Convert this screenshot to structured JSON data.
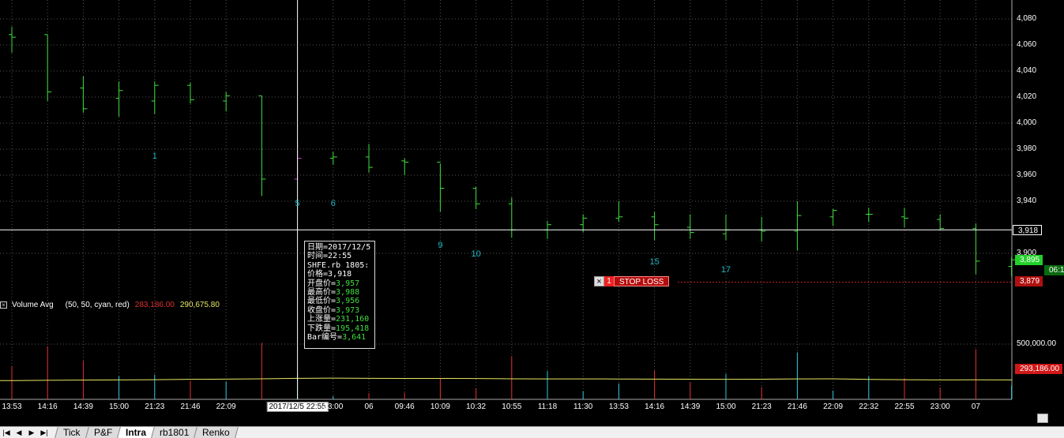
{
  "chart_data": {
    "type": "ohlc",
    "price_axis": {
      "ticks": [
        "4,080",
        "4,060",
        "4,040",
        "4,020",
        "4,000",
        "3,980",
        "3,960",
        "3,940",
        "3,900"
      ],
      "tick_values": [
        4080,
        4060,
        4040,
        4020,
        4000,
        3980,
        3960,
        3940,
        3900
      ]
    },
    "volume_axis": {
      "tick": "500,000.00"
    },
    "bars": [
      {
        "h": 4074,
        "l": 4054,
        "o": 4068,
        "c": 4066,
        "dir": "up",
        "vol": 302000
      },
      {
        "h": 4068,
        "l": 4017,
        "o": 4068,
        "c": 4024,
        "dir": "down",
        "vol": 479000
      },
      {
        "h": 4036,
        "l": 4008,
        "o": 4027,
        "c": 4011,
        "dir": "down",
        "vol": 348000
      },
      {
        "h": 4032,
        "l": 4005,
        "o": 4019,
        "c": 4025,
        "dir": "up",
        "vol": 209000
      },
      {
        "h": 4032,
        "l": 4007,
        "o": 4017,
        "c": 4029,
        "dir": "up",
        "vol": 224000
      },
      {
        "h": 4031,
        "l": 4015,
        "o": 4029,
        "c": 4018,
        "dir": "down",
        "vol": 168000
      },
      {
        "h": 4024,
        "l": 4009,
        "o": 4017,
        "c": 4021,
        "dir": "up",
        "vol": 162000
      },
      {
        "h": 4021,
        "l": 3944,
        "o": 4021,
        "c": 3957,
        "dir": "down",
        "vol": 511000
      },
      {
        "h": 3988,
        "l": 3956,
        "o": 3957,
        "c": 3973,
        "dir": "up",
        "vol": 231160
      },
      {
        "h": 3978,
        "l": 3968,
        "o": 3973,
        "c": 3974,
        "dir": "up",
        "vol": 30000
      },
      {
        "h": 3984,
        "l": 3962,
        "o": 3974,
        "c": 3966,
        "dir": "down",
        "vol": 56000
      },
      {
        "h": 3973,
        "l": 3960,
        "o": 3971,
        "c": 3970,
        "dir": "down",
        "vol": 61000
      },
      {
        "h": 3969,
        "l": 3932,
        "o": 3970,
        "c": 3950,
        "dir": "down",
        "vol": 192000
      },
      {
        "h": 3951,
        "l": 3934,
        "o": 3950,
        "c": 3938,
        "dir": "down",
        "vol": 101000
      },
      {
        "h": 3943,
        "l": 3912,
        "o": 3938,
        "c": 3918,
        "dir": "down",
        "vol": 390000
      },
      {
        "h": 3925,
        "l": 3911,
        "o": 3918,
        "c": 3922,
        "dir": "up",
        "vol": 256000
      },
      {
        "h": 3930,
        "l": 3916,
        "o": 3922,
        "c": 3927,
        "dir": "up",
        "vol": 75000
      },
      {
        "h": 3940,
        "l": 3924,
        "o": 3927,
        "c": 3928,
        "dir": "up",
        "vol": 144000
      },
      {
        "h": 3932,
        "l": 3910,
        "o": 3928,
        "c": 3922,
        "dir": "down",
        "vol": 262000
      },
      {
        "h": 3930,
        "l": 3911,
        "o": 3920,
        "c": 3916,
        "dir": "down",
        "vol": 154000
      },
      {
        "h": 3930,
        "l": 3910,
        "o": 3915,
        "c": 3918,
        "dir": "up",
        "vol": 230000
      },
      {
        "h": 3928,
        "l": 3909,
        "o": 3918,
        "c": 3917,
        "dir": "down",
        "vol": 112000
      },
      {
        "h": 3940,
        "l": 3902,
        "o": 3917,
        "c": 3929,
        "dir": "up",
        "vol": 424000
      },
      {
        "h": 3934,
        "l": 3921,
        "o": 3928,
        "c": 3933,
        "dir": "up",
        "vol": 79000
      },
      {
        "h": 3935,
        "l": 3924,
        "o": 3930,
        "c": 3930,
        "dir": "down",
        "vol": 207000
      },
      {
        "h": 3935,
        "l": 3920,
        "o": 3928,
        "c": 3927,
        "dir": "down",
        "vol": 192000
      },
      {
        "h": 3930,
        "l": 3918,
        "o": 3926,
        "c": 3919,
        "dir": "down",
        "vol": 107000
      },
      {
        "h": 3923,
        "l": 3884,
        "o": 3919,
        "c": 3894,
        "dir": "down",
        "vol": 454000
      },
      {
        "h": 3897,
        "l": 3882,
        "o": 3890,
        "c": 3895,
        "dir": "up",
        "vol": 126000
      }
    ],
    "volume_avg": [
      170000,
      172000,
      174000,
      176000,
      178000,
      181000,
      183000,
      186000,
      190000,
      192000,
      190000,
      189000,
      189000,
      188000,
      186000,
      185000,
      185000,
      184000,
      183000,
      182000,
      181000,
      182000,
      185000,
      186000,
      180000,
      178000,
      176000,
      177000,
      176000
    ],
    "bar_index_labels": [
      {
        "bar": 4,
        "text": "1",
        "price": 3978
      },
      {
        "bar": 8,
        "text": "5",
        "price": 3942
      },
      {
        "bar": 9,
        "text": "6",
        "price": 3942
      },
      {
        "bar": 12,
        "text": "9",
        "price": 3910
      },
      {
        "bar": 13,
        "text": "10",
        "price": 3903
      },
      {
        "bar": 18,
        "text": "15",
        "price": 3897
      },
      {
        "bar": 20,
        "text": "17",
        "price": 3891
      }
    ],
    "price_tags": [
      {
        "text": "3,918",
        "style": "crosshair",
        "price": 3918
      },
      {
        "text": "3,895",
        "style": "last",
        "price": 3895
      },
      {
        "text": "06:1",
        "style": "countdown",
        "price": 3887
      },
      {
        "text": "3,879",
        "style": "stop",
        "price": 3879
      },
      {
        "text": "293,186.00",
        "style": "volume",
        "price": null
      }
    ],
    "crosshair": {
      "bar": 8,
      "price": 3918
    },
    "stop_price": 3879,
    "time_labels": [
      "13:53",
      "14:16",
      "14:39",
      "15:00",
      "21:23",
      "21:46",
      "22:09",
      "2017/12/5 22:55",
      "23:00",
      "06",
      "09:46",
      "10:09",
      "10:32",
      "10:55",
      "11:18",
      "11:30",
      "13:53",
      "14:16",
      "14:39",
      "15:00",
      "21:23",
      "21:46",
      "22:09",
      "22:32",
      "22:55",
      "23:00",
      "07"
    ],
    "time_label_bar": [
      0,
      1,
      2,
      3,
      4,
      5,
      6,
      8,
      9,
      10,
      11,
      12,
      13,
      14,
      15,
      16,
      17,
      18,
      19,
      20,
      21,
      22,
      23,
      24,
      25,
      26,
      27
    ],
    "colors": {
      "up": "#3ede3e",
      "down": "#3ede3e",
      "highlight": "#c040c0",
      "vol_down": "#e03030",
      "vol_up": "#30c8e0",
      "avg": "#e8e860",
      "grid": "#555"
    }
  },
  "tooltip": {
    "lines": [
      {
        "k": "日期=",
        "v": "2017/12/5",
        "vclass": "w"
      },
      {
        "k": "时间=",
        "v": "22:55",
        "vclass": "w"
      },
      {
        "k": "SHFE.rb 1805:",
        "v": "",
        "vclass": "w"
      },
      {
        "k": "价格=",
        "v": "3,918",
        "vclass": "w"
      },
      {
        "k": "开盘价=",
        "v": "3,957",
        "vclass": "g"
      },
      {
        "k": "最高价=",
        "v": "3,988",
        "vclass": "g"
      },
      {
        "k": "最低价=",
        "v": "3,956",
        "vclass": "g"
      },
      {
        "k": "收盘价=",
        "v": "3,973",
        "vclass": "g"
      },
      {
        "k": "上涨量=",
        "v": "231,160",
        "vclass": "g"
      },
      {
        "k": "下跌量=",
        "v": "195,418",
        "vclass": "g"
      },
      {
        "k": "Bar编号=",
        "v": "3,641",
        "vclass": "g"
      }
    ]
  },
  "study": {
    "close": "×",
    "name": "Volume Avg",
    "params": "(50, 50, cyan, red)",
    "value1": "283,186.00",
    "value2": "290,675.80",
    "value1_color": "#e03030",
    "value2_color": "#e8e860"
  },
  "stop_loss": {
    "close": "×",
    "qty": "1",
    "label": "STOP LOSS"
  },
  "tabs": {
    "nav": [
      "|◀",
      "◀",
      "▶",
      "▶|"
    ],
    "items": [
      {
        "label": "Tick",
        "active": false
      },
      {
        "label": "P&F",
        "active": false
      },
      {
        "label": "Intra",
        "active": true
      },
      {
        "label": "rb1801",
        "active": false
      },
      {
        "label": "Renko",
        "active": false
      }
    ]
  }
}
